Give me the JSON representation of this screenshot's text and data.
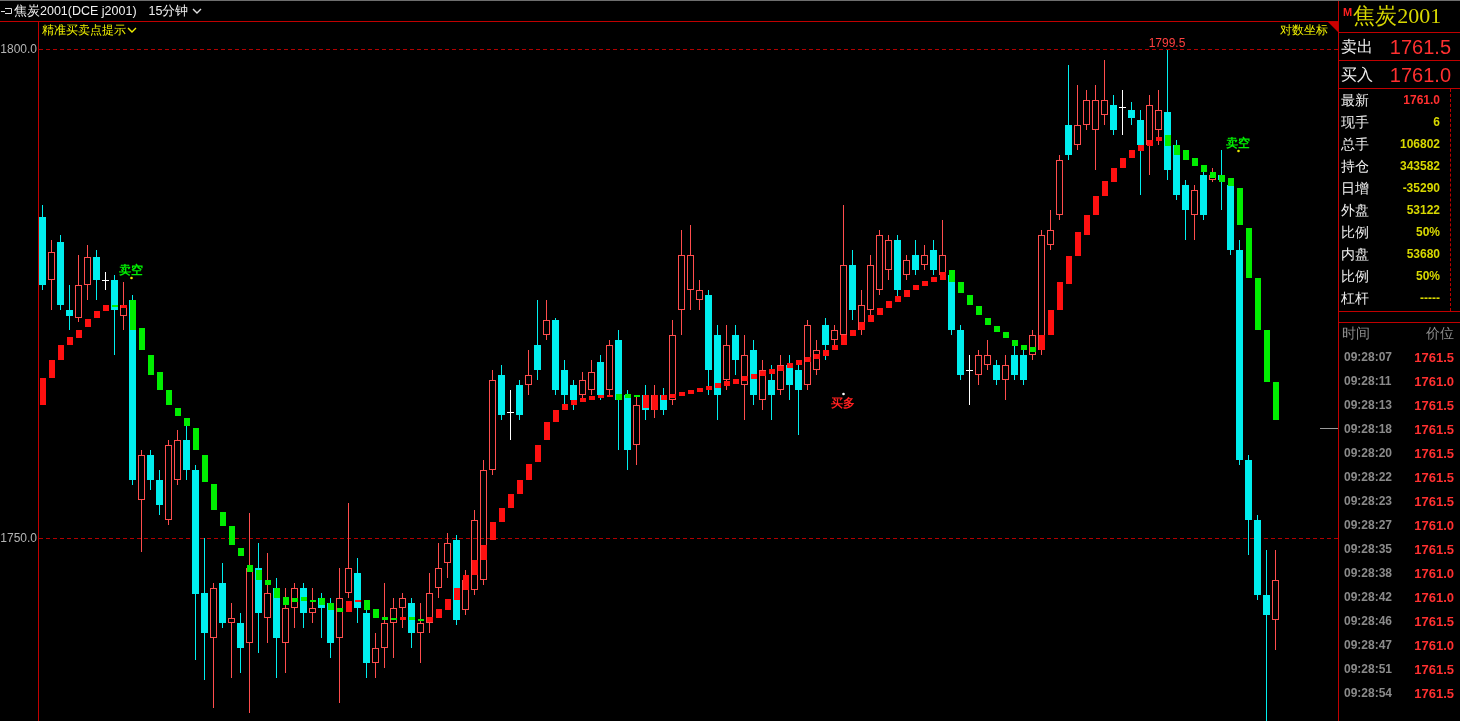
{
  "title_bar": {
    "symbol": "焦炭2001(DCE j2001)",
    "period": "15分钟"
  },
  "chart": {
    "indicator": "精准买卖点提示",
    "scale": "对数坐标",
    "price_ticks": [
      "1800.0",
      "1750.0"
    ],
    "high_label": "1799.5",
    "signals": [
      {
        "kind": "sell",
        "label": "卖空"
      },
      {
        "kind": "buy",
        "label": "买多"
      },
      {
        "kind": "sell",
        "label": "卖空"
      }
    ]
  },
  "quote_panel": {
    "badge": "M",
    "name": "焦炭2001",
    "quotes": [
      {
        "label": "卖出",
        "value": "1761.5"
      },
      {
        "label": "买入",
        "value": "1761.0"
      }
    ],
    "stats": [
      {
        "label": "最新",
        "value": "1761.0",
        "kind": "price"
      },
      {
        "label": "现手",
        "value": "6",
        "kind": "figure"
      },
      {
        "label": "总手",
        "value": "106802",
        "kind": "figure"
      },
      {
        "label": "持仓",
        "value": "343582",
        "kind": "figure"
      },
      {
        "label": "日增",
        "value": "-35290",
        "kind": "figure"
      },
      {
        "label": "外盘",
        "value": "53122",
        "kind": "figure"
      },
      {
        "label": "比例",
        "value": "50%",
        "kind": "figure"
      },
      {
        "label": "内盘",
        "value": "53680",
        "kind": "figure"
      },
      {
        "label": "比例",
        "value": "50%",
        "kind": "figure"
      },
      {
        "label": "杠杆",
        "value": "-----",
        "kind": "figure"
      }
    ],
    "trades": {
      "columns": [
        "时间",
        "价位"
      ],
      "rows": [
        {
          "time": "09:28:07",
          "price": "1761.5"
        },
        {
          "time": "09:28:11",
          "price": "1761.0"
        },
        {
          "time": "09:28:13",
          "price": "1761.5"
        },
        {
          "time": "09:28:18",
          "price": "1761.5"
        },
        {
          "time": "09:28:20",
          "price": "1761.5"
        },
        {
          "time": "09:28:22",
          "price": "1761.5"
        },
        {
          "time": "09:28:23",
          "price": "1761.5"
        },
        {
          "time": "09:28:27",
          "price": "1761.0"
        },
        {
          "time": "09:28:35",
          "price": "1761.5"
        },
        {
          "time": "09:28:38",
          "price": "1761.0"
        },
        {
          "time": "09:28:42",
          "price": "1761.0"
        },
        {
          "time": "09:28:46",
          "price": "1761.5"
        },
        {
          "time": "09:28:47",
          "price": "1761.0"
        },
        {
          "time": "09:28:51",
          "price": "1761.5"
        },
        {
          "time": "09:28:54",
          "price": "1761.5"
        }
      ]
    }
  }
}
